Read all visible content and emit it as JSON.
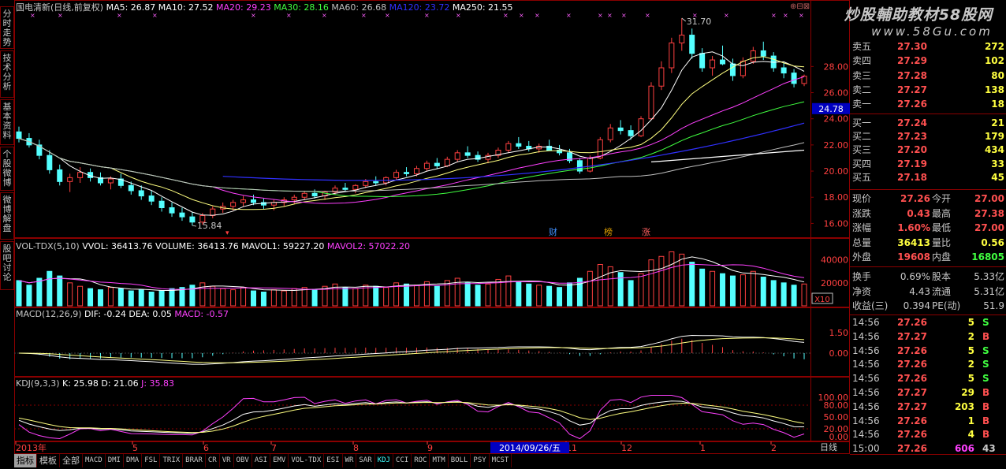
{
  "main_header": {
    "title": "国电清新(日线,前复权)",
    "items": [
      {
        "label": "MA5: 26.87",
        "color": "#ffffff"
      },
      {
        "label": "MA10: 27.52",
        "color": "#ffffff"
      },
      {
        "label": "MA20: 29.23",
        "color": "#ff40ff"
      },
      {
        "label": "MA30: 28.16",
        "color": "#40ff40"
      },
      {
        "label": "MA60: 26.68",
        "color": "#c0c0c0"
      },
      {
        "label": "MA120: 23.72",
        "color": "#3030ff"
      },
      {
        "label": "MA250: 21.55",
        "color": "#ffffff"
      }
    ]
  },
  "watermark": {
    "line1": "炒股輔助教材58股网",
    "line2": "www.58Gu.com"
  },
  "left_tabs": [
    {
      "label": "分时走势"
    },
    {
      "label": "技术分析"
    },
    {
      "label": "基本资料"
    },
    {
      "label": "个股微博"
    },
    {
      "label": "微博解盘"
    },
    {
      "label": "股吧讨论"
    }
  ],
  "price_axis": {
    "labels": [
      "28.00",
      "26.00",
      "24.00",
      "22.00",
      "20.00",
      "18.00",
      "16.00"
    ],
    "current": "24.78"
  },
  "price_annotations": {
    "high": "31.70",
    "low": "15.84"
  },
  "event_markers": [
    {
      "label": "财",
      "color": "#4090ff"
    },
    {
      "label": "榜",
      "color": "#e0a000"
    },
    {
      "label": "涨",
      "color": "#ff6060"
    }
  ],
  "vol_header": {
    "title": "VOL-TDX(5,10)",
    "items": [
      {
        "label": "VVOL: 36413.76",
        "color": "#ffffff"
      },
      {
        "label": "VOLUME: 36413.76",
        "color": "#ffffff"
      },
      {
        "label": "MAVOL1: 59227.20",
        "color": "#ffffff"
      },
      {
        "label": "MAVOL2: 57022.20",
        "color": "#ff40ff"
      }
    ]
  },
  "vol_axis": {
    "labels": [
      "40000",
      "20000"
    ],
    "unit": "X10"
  },
  "macd_header": {
    "title": "MACD(12,26,9)",
    "items": [
      {
        "label": "DIF: -0.24",
        "color": "#ffffff"
      },
      {
        "label": "DEA: 0.05",
        "color": "#ffffff"
      },
      {
        "label": "MACD: -0.57",
        "color": "#ff40ff"
      }
    ]
  },
  "macd_axis": {
    "labels": [
      "1.50",
      "0.00"
    ]
  },
  "kdj_header": {
    "title": "KDJ(9,3,3)",
    "items": [
      {
        "label": "K: 25.98",
        "color": "#ffffff"
      },
      {
        "label": "D: 21.06",
        "color": "#ffffff"
      },
      {
        "label": "J: 35.83",
        "color": "#ff40ff"
      }
    ]
  },
  "kdj_axis": {
    "labels": [
      "100.00",
      "80.00",
      "50.00",
      "20.00",
      "0.00"
    ]
  },
  "time_axis": {
    "labels": [
      "2013年",
      "5",
      "6",
      "7",
      "8",
      "9",
      "11",
      "12",
      "1",
      "2"
    ],
    "cursor_date": "2014/09/26/五"
  },
  "period_label": "日线",
  "order_book": {
    "sell": [
      {
        "label": "卖五",
        "price": "27.30",
        "vol": "272"
      },
      {
        "label": "卖四",
        "price": "27.29",
        "vol": "102"
      },
      {
        "label": "卖三",
        "price": "27.28",
        "vol": "80"
      },
      {
        "label": "卖二",
        "price": "27.27",
        "vol": "138"
      },
      {
        "label": "卖一",
        "price": "27.26",
        "vol": "18"
      }
    ],
    "buy": [
      {
        "label": "买一",
        "price": "27.24",
        "vol": "21"
      },
      {
        "label": "买二",
        "price": "27.23",
        "vol": "179"
      },
      {
        "label": "买三",
        "price": "27.20",
        "vol": "434"
      },
      {
        "label": "买四",
        "price": "27.19",
        "vol": "33"
      },
      {
        "label": "买五",
        "price": "27.18",
        "vol": "45"
      }
    ]
  },
  "quote": [
    {
      "l1": "现价",
      "v1": "27.26",
      "c1": "#ff5050",
      "l2": "今开",
      "v2": "27.00",
      "c2": "#ff5050"
    },
    {
      "l1": "涨跌",
      "v1": "0.43",
      "c1": "#ff5050",
      "l2": "最高",
      "v2": "27.38",
      "c2": "#ff5050"
    },
    {
      "l1": "涨幅",
      "v1": "1.60%",
      "c1": "#ff5050",
      "l2": "最低",
      "v2": "27.00",
      "c2": "#ff5050"
    },
    {
      "l1": "总量",
      "v1": "36413",
      "c1": "#ffff40",
      "l2": "量比",
      "v2": "0.56",
      "c2": "#ffff40"
    },
    {
      "l1": "外盘",
      "v1": "19608",
      "c1": "#ff5050",
      "l2": "内盘",
      "v2": "16805",
      "c2": "#40ff40"
    }
  ],
  "fundamentals": [
    {
      "l1": "换手",
      "v1": "0.69%",
      "l2": "股本",
      "v2": "5.33亿"
    },
    {
      "l1": "净资",
      "v1": "4.43",
      "l2": "流通",
      "v2": "5.31亿"
    },
    {
      "l1": "收益(三)",
      "v1": "0.394",
      "l2": "PE(动)",
      "v2": "51.9"
    }
  ],
  "ticks": [
    {
      "time": "14:56",
      "price": "27.26",
      "vol": "5",
      "side": "S"
    },
    {
      "time": "14:56",
      "price": "27.27",
      "vol": "2",
      "side": "B"
    },
    {
      "time": "14:56",
      "price": "27.26",
      "vol": "5",
      "side": "S"
    },
    {
      "time": "14:56",
      "price": "27.26",
      "vol": "2",
      "side": "S"
    },
    {
      "time": "14:56",
      "price": "27.26",
      "vol": "5",
      "side": "S"
    },
    {
      "time": "14:56",
      "price": "27.27",
      "vol": "29",
      "side": "B"
    },
    {
      "time": "14:56",
      "price": "27.27",
      "vol": "203",
      "side": "B"
    },
    {
      "time": "14:56",
      "price": "27.26",
      "vol": "1",
      "side": "B"
    },
    {
      "time": "14:56",
      "price": "27.26",
      "vol": "4",
      "side": "B"
    },
    {
      "time": "15:00",
      "price": "27.26",
      "vol": "606",
      "side": "43"
    }
  ],
  "bottom_tabs": [
    "指标",
    "模板",
    "全部",
    "MACD",
    "DMI",
    "DMA",
    "FSL",
    "TRIX",
    "BRAR",
    "CR",
    "VR",
    "OBV",
    "ASI",
    "EMV",
    "VOL-TDX",
    "ESI",
    "WR",
    "SAR",
    "KDJ",
    "CCI",
    "ROC",
    "MTM",
    "BOLL",
    "PSY",
    "MCST"
  ],
  "colors": {
    "up": "#ff4040",
    "down": "#54ffff",
    "grid": "#8a0000",
    "bg": "#000000"
  },
  "chart_data": {
    "type": "candlestick",
    "x_range": [
      "2013",
      "2014-02"
    ],
    "ylim": [
      15.0,
      32.0
    ],
    "ohlc": [
      [
        23.0,
        23.4,
        22.2,
        22.5
      ],
      [
        22.5,
        22.9,
        21.8,
        22.0
      ],
      [
        22.0,
        22.4,
        20.9,
        21.2
      ],
      [
        21.2,
        21.6,
        19.8,
        20.1
      ],
      [
        20.1,
        20.5,
        18.9,
        19.2
      ],
      [
        19.2,
        19.8,
        18.4,
        19.5
      ],
      [
        19.5,
        20.3,
        19.1,
        19.9
      ],
      [
        19.9,
        20.2,
        19.2,
        19.5
      ],
      [
        19.5,
        19.9,
        18.9,
        19.1
      ],
      [
        19.1,
        19.6,
        18.6,
        19.4
      ],
      [
        19.4,
        19.8,
        18.7,
        18.9
      ],
      [
        18.9,
        19.2,
        18.2,
        18.5
      ],
      [
        18.5,
        18.9,
        17.8,
        18.1
      ],
      [
        18.1,
        18.5,
        17.4,
        17.7
      ],
      [
        17.7,
        18.0,
        16.9,
        17.2
      ],
      [
        17.2,
        17.6,
        16.5,
        16.8
      ],
      [
        16.8,
        17.2,
        16.2,
        16.5
      ],
      [
        16.5,
        16.9,
        15.84,
        16.1
      ],
      [
        16.1,
        16.8,
        15.9,
        16.6
      ],
      [
        16.6,
        17.3,
        16.4,
        17.1
      ],
      [
        17.1,
        17.6,
        16.8,
        17.3
      ],
      [
        17.3,
        17.8,
        17.0,
        17.6
      ],
      [
        17.6,
        18.1,
        17.3,
        17.8
      ],
      [
        17.8,
        18.2,
        17.4,
        17.6
      ],
      [
        17.6,
        17.9,
        17.1,
        17.4
      ],
      [
        17.4,
        17.8,
        17.0,
        17.6
      ],
      [
        17.6,
        18.0,
        17.3,
        17.8
      ],
      [
        17.8,
        18.2,
        17.5,
        18.0
      ],
      [
        18.0,
        18.5,
        17.8,
        18.3
      ],
      [
        18.3,
        18.6,
        17.9,
        18.1
      ],
      [
        18.1,
        18.5,
        17.8,
        18.4
      ],
      [
        18.4,
        18.9,
        18.2,
        18.7
      ],
      [
        18.7,
        19.1,
        18.4,
        18.6
      ],
      [
        18.6,
        19.0,
        18.3,
        18.9
      ],
      [
        18.9,
        19.4,
        18.7,
        19.2
      ],
      [
        19.2,
        19.6,
        18.9,
        19.1
      ],
      [
        19.1,
        19.6,
        18.9,
        19.5
      ],
      [
        19.5,
        20.1,
        19.3,
        19.9
      ],
      [
        19.9,
        20.3,
        19.6,
        19.8
      ],
      [
        19.8,
        20.4,
        19.6,
        20.2
      ],
      [
        20.2,
        20.8,
        20.0,
        20.6
      ],
      [
        20.6,
        21.0,
        20.2,
        20.4
      ],
      [
        20.4,
        21.1,
        20.3,
        20.9
      ],
      [
        20.9,
        21.6,
        20.7,
        21.4
      ],
      [
        21.4,
        21.9,
        21.0,
        21.2
      ],
      [
        21.2,
        21.5,
        20.7,
        20.9
      ],
      [
        20.9,
        21.4,
        20.6,
        21.2
      ],
      [
        21.2,
        21.8,
        21.0,
        21.6
      ],
      [
        21.6,
        22.3,
        21.4,
        22.1
      ],
      [
        22.1,
        22.6,
        21.7,
        21.9
      ],
      [
        21.9,
        22.3,
        21.5,
        21.7
      ],
      [
        21.7,
        22.1,
        21.4,
        21.9
      ],
      [
        21.9,
        22.4,
        21.6,
        21.6
      ],
      [
        21.6,
        22.0,
        21.2,
        21.4
      ],
      [
        21.4,
        21.7,
        20.6,
        20.8
      ],
      [
        20.8,
        21.0,
        19.8,
        20.0
      ],
      [
        20.0,
        21.2,
        19.9,
        21.0
      ],
      [
        21.0,
        22.6,
        20.9,
        22.4
      ],
      [
        22.4,
        23.6,
        22.2,
        23.3
      ],
      [
        23.3,
        23.9,
        22.8,
        23.1
      ],
      [
        23.1,
        23.5,
        22.4,
        22.7
      ],
      [
        22.7,
        24.2,
        22.6,
        24.0
      ],
      [
        24.0,
        26.8,
        23.9,
        26.5
      ],
      [
        26.5,
        28.4,
        26.2,
        27.9
      ],
      [
        27.9,
        30.2,
        27.5,
        29.8
      ],
      [
        29.8,
        31.7,
        29.2,
        30.4
      ],
      [
        30.4,
        30.9,
        28.6,
        29.0
      ],
      [
        29.0,
        29.4,
        27.6,
        27.9
      ],
      [
        27.9,
        28.8,
        27.3,
        28.5
      ],
      [
        28.5,
        29.6,
        28.1,
        28.2
      ],
      [
        28.2,
        28.6,
        26.9,
        27.3
      ],
      [
        27.3,
        28.7,
        27.1,
        28.4
      ],
      [
        28.4,
        29.5,
        28.2,
        29.2
      ],
      [
        29.2,
        29.9,
        28.5,
        28.8
      ],
      [
        28.8,
        29.1,
        27.6,
        27.9
      ],
      [
        27.9,
        28.3,
        27.1,
        27.5
      ],
      [
        27.5,
        27.8,
        26.4,
        26.7
      ],
      [
        26.7,
        27.38,
        26.5,
        27.26
      ]
    ],
    "ma_lines": [
      {
        "name": "MA5",
        "value": 26.87
      },
      {
        "name": "MA10",
        "value": 27.52
      },
      {
        "name": "MA20",
        "value": 29.23
      },
      {
        "name": "MA30",
        "value": 28.16
      },
      {
        "name": "MA60",
        "value": 26.68
      },
      {
        "name": "MA120",
        "value": 23.72
      },
      {
        "name": "MA250",
        "value": 21.55
      }
    ],
    "volume": [
      22000,
      18000,
      24000,
      30000,
      26000,
      20000,
      17000,
      15000,
      14000,
      16000,
      15000,
      13000,
      14000,
      12000,
      13000,
      15000,
      16000,
      18000,
      20000,
      17000,
      15000,
      14000,
      16000,
      13000,
      12000,
      14000,
      13000,
      15000,
      16000,
      14000,
      17000,
      19000,
      16000,
      15000,
      18000,
      17000,
      16000,
      20000,
      19000,
      18000,
      21000,
      17000,
      22000,
      24000,
      20000,
      18000,
      19000,
      23000,
      26000,
      21000,
      19000,
      18000,
      17000,
      16000,
      20000,
      24000,
      30000,
      36000,
      34000,
      29000,
      22000,
      28000,
      40000,
      43000,
      47000,
      45000,
      38000,
      32000,
      30000,
      28000,
      26000,
      27000,
      30000,
      25000,
      22000,
      20000,
      18000,
      19000
    ],
    "kdj": {
      "K": 25.98,
      "D": 21.06,
      "J": 35.83
    },
    "macd": {
      "DIF": -0.24,
      "DEA": 0.05,
      "MACD": -0.57
    }
  }
}
